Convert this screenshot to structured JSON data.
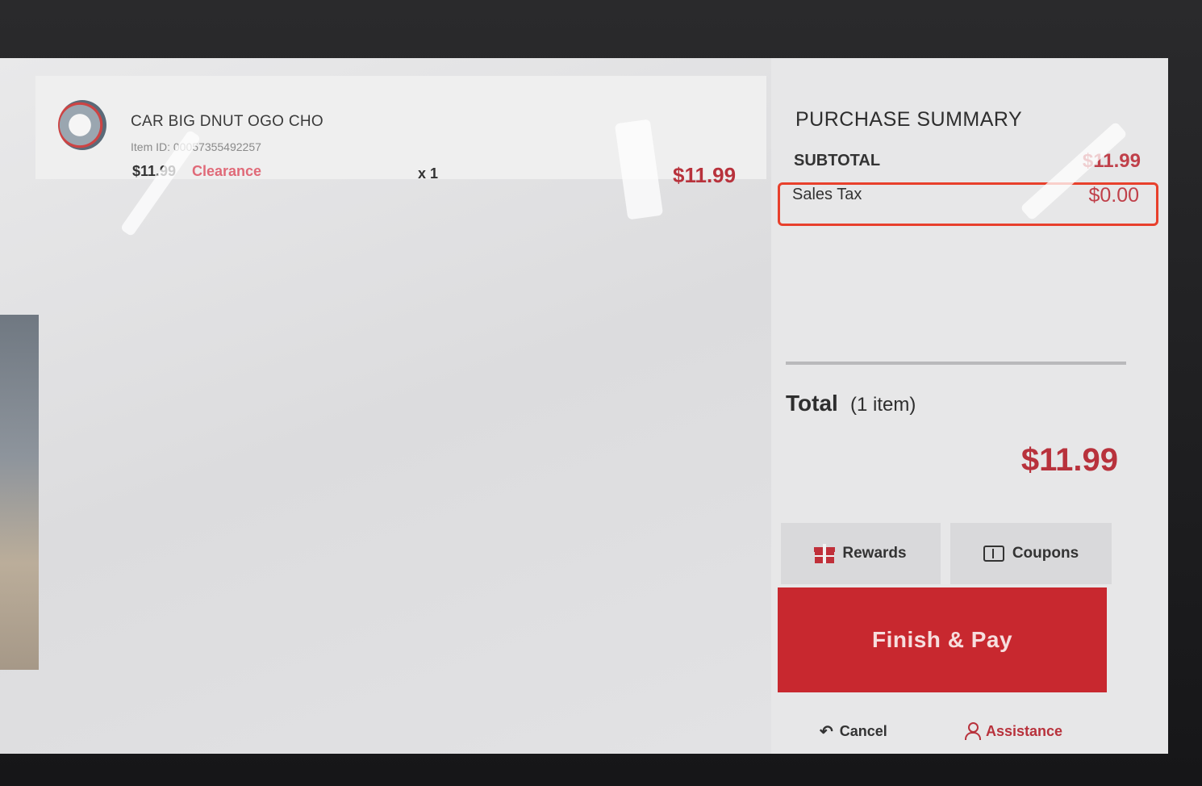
{
  "cart": {
    "items": [
      {
        "name": "CAR BIG DNUT OGO CHO",
        "item_id": "Item ID: 00057355492257",
        "unit_price": "$11.99",
        "tag": "Clearance",
        "quantity": "x 1",
        "line_total": "$11.99",
        "thumbnail_icon": "product-thumbnail"
      }
    ]
  },
  "summary": {
    "title": "PURCHASE SUMMARY",
    "subtotal_label": "SUBTOTAL",
    "subtotal_value": "$11.99",
    "tax_label": "Sales Tax",
    "tax_value": "$0.00",
    "total_label": "Total",
    "total_count": "(1 item)",
    "total_value": "$11.99"
  },
  "actions": {
    "rewards_label": "Rewards",
    "coupons_label": "Coupons",
    "finish_label": "Finish & Pay",
    "cancel_label": "Cancel",
    "assistance_label": "Assistance"
  },
  "colors": {
    "accent_red": "#c8282f",
    "price_red": "#b8323c",
    "highlight_box": "#e8402c"
  }
}
